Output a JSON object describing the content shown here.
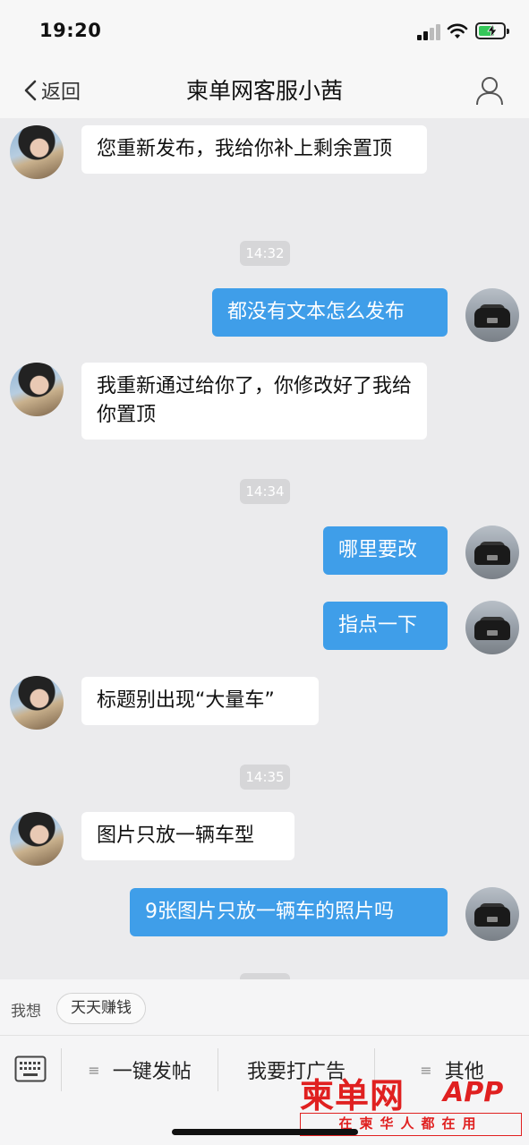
{
  "status_bar": {
    "time": "19:20"
  },
  "nav": {
    "back_label": "返回",
    "title": "柬单网客服小茜"
  },
  "messages": [
    {
      "side": "in",
      "text": "您重新发布，我给你补上剩余置顶"
    },
    {
      "type": "timestamp",
      "text": "14:32"
    },
    {
      "side": "out",
      "text": "都没有文本怎么发布"
    },
    {
      "side": "in",
      "text": "我重新通过给你了，你修改好了我给你置顶"
    },
    {
      "type": "timestamp",
      "text": "14:34"
    },
    {
      "side": "out",
      "text": "哪里要改"
    },
    {
      "side": "out",
      "text": "指点一下"
    },
    {
      "side": "in",
      "text": "标题别出现“大量车”"
    },
    {
      "type": "timestamp",
      "text": "14:35"
    },
    {
      "side": "in",
      "text": "图片只放一辆车型"
    },
    {
      "side": "out",
      "text": "9张图片只放一辆车的照片吗"
    }
  ],
  "quick_reply": {
    "label": "我想",
    "chip": "天天赚钱"
  },
  "menu": {
    "items": [
      "一键发帖",
      "我要打广告",
      "其他"
    ]
  },
  "watermark": {
    "brand": "柬单网",
    "app": "APP",
    "slogan": "在柬华人都在用"
  },
  "colors": {
    "outgoing_bubble": "#3f9ee9",
    "incoming_bubble": "#ffffff",
    "background": "#ebebed",
    "watermark": "#e02020"
  },
  "icons": [
    "back-chevron-icon",
    "user-profile-icon",
    "keyboard-icon",
    "menu-lines-icon",
    "signal-icon",
    "wifi-icon",
    "battery-charging-icon"
  ]
}
